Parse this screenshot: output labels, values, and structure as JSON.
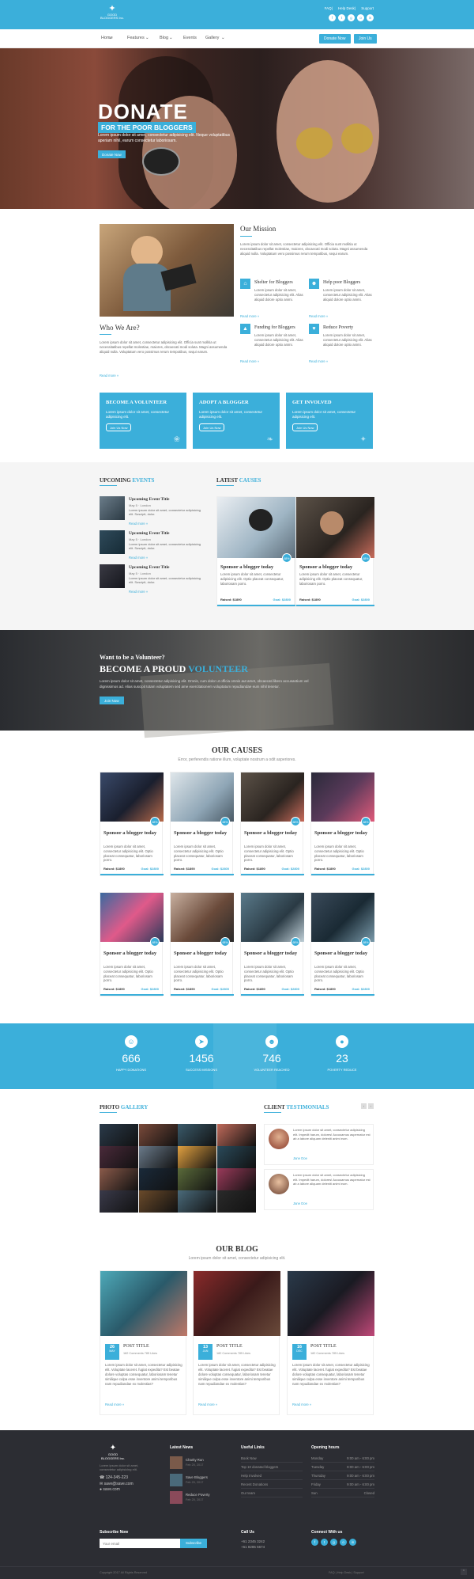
{
  "logo": {
    "name": "GOOD BLOGGERS Inc."
  },
  "top_links": [
    "FAQ",
    "Help Desk",
    "Support"
  ],
  "social_icons": [
    "facebook-icon",
    "twitter-icon",
    "google-plus-icon",
    "instagram-icon",
    "linkedin-icon"
  ],
  "nav": {
    "items": [
      "Home",
      "Features",
      "Blog",
      "Events",
      "Gallery"
    ],
    "donate": "Donate Now",
    "join": "Join Us"
  },
  "hero": {
    "title": "DONATE",
    "subtitle": "FOR THE POOR BLOGGERS",
    "text": "Lorem ipsum dolor sit amet, consectetur adipisicing elit. Neque voluptatibus aperiam nihil, earum consectetur laboriosam.",
    "button": "Donate Now"
  },
  "who": {
    "title": "Who We Are?",
    "text": "Lorem ipsum dolor sit amet, consectetur adipisicing elit. Officia sunt mollitia ut necessitatibus repellat molestiae, maiores, obcaecati modi soluta. Magni assumenda aliquid nulla. Voluptatum vero possimus rerum tempotibus, sequi earum.",
    "more": "Read more"
  },
  "mission": {
    "title": "Our Mission",
    "text": "Lorem ipsum dolor sit amet, consectetur adipisicing elit. Officia sunt mollitia ut necessitatibus repellat molestiae, maiores, obcaecati modi soluta. Magni assumenda aliquid nulla. Voluptatum vero possimus rerum tempotibus, sequi earum.",
    "features": [
      {
        "title": "Shelter for Bloggers",
        "text": "Lorem ipsum dolor sit amet, consectetur adipisicing elit. Alias aliquid dolore optio animi.",
        "more": "Read more"
      },
      {
        "title": "Help poor Bloggers",
        "text": "Lorem ipsum dolor sit amet, consectetur adipisicing elit. Alias aliquid dolore optio animi.",
        "more": "Read more"
      },
      {
        "title": "Funding for Bloggers",
        "text": "Lorem ipsum dolor sit amet, consectetur adipisicing elit. Alias aliquid dolore optio animi.",
        "more": "Read more"
      },
      {
        "title": "Reduce Poverty",
        "text": "Lorem ipsum dolor sit amet, consectetur adipisicing elit. Alias aliquid dolore optio animi.",
        "more": "Read more"
      }
    ]
  },
  "boxes": [
    {
      "title": "BECOME A VOLUNTEER",
      "text": "Lorem ipsum dolor sit amet, consectetur adipisicing elit.",
      "button": "Join Us Now"
    },
    {
      "title": "ADOPT A BLOGGER",
      "text": "Lorem ipsum dolor sit amet, consectetur adipisicing elit.",
      "button": "Join Us Now"
    },
    {
      "title": "GET INVOLVED",
      "text": "Lorem ipsum dolor sit amet, consectetur adipisicing elit.",
      "button": "Join Us Now"
    }
  ],
  "events": {
    "title_a": "UPCOMING ",
    "title_b": "EVENTS",
    "items": [
      {
        "title": "Upcoming Event Title",
        "meta": "May 5 · London",
        "text": "Lorem ipsum dolor sit amet, consectetur adipisicing elit. Suscipit, dolor.",
        "more": "Read more"
      },
      {
        "title": "Upcoming Event Title",
        "meta": "May 5 · London",
        "text": "Lorem ipsum dolor sit amet, consectetur adipisicing elit. Suscipit, dolor.",
        "more": "Read more"
      },
      {
        "title": "Upcoming Event Title",
        "meta": "May 5 · London",
        "text": "Lorem ipsum dolor sit amet, consectetur adipisicing elit. Suscipit, dolor.",
        "more": "Read more"
      }
    ]
  },
  "latest": {
    "title_a": "LATEST ",
    "title_b": "CAUSES",
    "items": [
      {
        "title": "Sponsor a blogger today",
        "text": "Lorem ipsum dolor sit amet, consectetur adipisicing elit. Optio placeat consequatur, laboriosam porro.",
        "raised": "Raised: $1890",
        "goal": "Goal: $2800",
        "pct": "68%"
      },
      {
        "title": "Sponsor a blogger today",
        "text": "Lorem ipsum dolor sit amet, consectetur adipisicing elit. Optio placeat consequatur, laboriosam porro.",
        "raised": "Raised: $1890",
        "goal": "Goal: $2800",
        "pct": "68%"
      }
    ]
  },
  "volunteer": {
    "pre": "Want to be a Volunteer?",
    "title_a": "BECOME A PROUD ",
    "title_b": "VOLUNTEER",
    "text": "Lorem ipsum dolor sit amet, consectetur adipisicing elit. Omnis, cum dolor ut officia omnis aut amet, obcaecati libero accusantium vel dignissimos ad. Alias suscipit totam voluptatem sed ame exercitationem voluptatum repudiandae eum nihil tenetur.",
    "button": "Join Now"
  },
  "causes": {
    "title": "OUR CAUSES",
    "subtitle": "Error, perferendis ratione illum, voluptate nostrum a odit asperiores.",
    "items": [
      {
        "title": "Sponsor a blogger today",
        "text": "Lorem ipsum dolor sit amet, consectetur adipisicing elit. Optio placeat consequatur, laboriosam porro.",
        "raised": "Raised: $1890",
        "goal": "Goal: $2800",
        "pct": "68%"
      },
      {
        "title": "Sponsor a blogger today",
        "text": "Lorem ipsum dolor sit amet, consectetur adipisicing elit. Optio placeat consequatur, laboriosam porro.",
        "raised": "Raised: $1890",
        "goal": "Goal: $2800",
        "pct": "68%"
      },
      {
        "title": "Sponsor a blogger today",
        "text": "Lorem ipsum dolor sit amet, consectetur adipisicing elit. Optio placeat consequatur, laboriosam porro.",
        "raised": "Raised: $1890",
        "goal": "Goal: $2800",
        "pct": "68%"
      },
      {
        "title": "Sponsor a blogger today",
        "text": "Lorem ipsum dolor sit amet, consectetur adipisicing elit. Optio placeat consequatur, laboriosam porro.",
        "raised": "Raised: $1890",
        "goal": "Goal: $2800",
        "pct": "68%"
      },
      {
        "title": "Sponsor a blogger today",
        "text": "Lorem ipsum dolor sit amet, consectetur adipisicing elit. Optio placeat consequatur, laboriosam porro.",
        "raised": "Raised: $1890",
        "goal": "Goal: $2800",
        "pct": "68%"
      },
      {
        "title": "Sponsor a blogger today",
        "text": "Lorem ipsum dolor sit amet, consectetur adipisicing elit. Optio placeat consequatur, laboriosam porro.",
        "raised": "Raised: $1890",
        "goal": "Goal: $2800",
        "pct": "68%"
      },
      {
        "title": "Sponsor a blogger today",
        "text": "Lorem ipsum dolor sit amet, consectetur adipisicing elit. Optio placeat consequatur, laboriosam porro.",
        "raised": "Raised: $1890",
        "goal": "Goal: $2800",
        "pct": "68%"
      },
      {
        "title": "Sponsor a blogger today",
        "text": "Lorem ipsum dolor sit amet, consectetur adipisicing elit. Optio placeat consequatur, laboriosam porro.",
        "raised": "Raised: $1890",
        "goal": "Goal: $2800",
        "pct": "68%"
      }
    ]
  },
  "counters": [
    {
      "icon": "smile-icon",
      "num": "666",
      "label": "HAPPY DONATIONS"
    },
    {
      "icon": "rocket-icon",
      "num": "1456",
      "label": "SUCCESS MISSIONS"
    },
    {
      "icon": "users-icon",
      "num": "746",
      "label": "VOLUNTEER REACHED"
    },
    {
      "icon": "globe-icon",
      "num": "23",
      "label": "POVERTY REDUCE"
    }
  ],
  "gallery": {
    "title_a": "PHOTO ",
    "title_b": "GALLERY"
  },
  "testimonials": {
    "title_a": "CLIENT ",
    "title_b": "TESTIMONIALS",
    "items": [
      {
        "text": "Lorem ipsum dolor sit amet, consectetur adipisicing elit. Impedit harum, dolores! Accusamus aspernatur est ab a labore aliquam deleniti animi eum.",
        "name": "Jane Doe"
      },
      {
        "text": "Lorem ipsum dolor sit amet, consectetur adipisicing elit. Impedit harum, dolores! Accusamus aspernatur est ab a labore aliquam deleniti animi eum.",
        "name": "Jane Doe"
      }
    ]
  },
  "blog": {
    "title": "OUR BLOG",
    "subtitle": "Lorem ipsum dolor sit amet, consectetur adipisicing elit.",
    "posts": [
      {
        "day": "26",
        "month": "MAY",
        "title": "POST TITLE",
        "meta": "182 Comments  785 Likes",
        "text": "Lorem ipsum dolor sit amet, consectetur adipisicing elit. Voluptate laceret. fugiat expedita? Est beatae dolore voluptas consequatur, laboriosam tenetur similique culpa esse inventore animi temporibus nam repudiandae ex molestias?",
        "more": "Read more"
      },
      {
        "day": "13",
        "month": "JUN",
        "title": "POST TITLE",
        "meta": "182 Comments  785 Likes",
        "text": "Lorem ipsum dolor sit amet, consectetur adipisicing elit. Voluptate laceret. fugiat expedita? Est beatae dolore voluptas consequatur, laboriosam tenetur similique culpa esse inventore animi temporibus nam repudiandae ex molestias?",
        "more": "Read more"
      },
      {
        "day": "16",
        "month": "DEC",
        "title": "POST TITLE",
        "meta": "182 Comments  785 Likes",
        "text": "Lorem ipsum dolor sit amet, consectetur adipisicing elit. Voluptate laceret. fugiat expedita? Est beatae dolore voluptas consequatur, laboriosam tenetur similique culpa esse inventore animi temporibus nam repudiandae ex molestias?",
        "more": "Read more"
      }
    ]
  },
  "footer": {
    "about": "GOOD BLOGGERS Inc.",
    "about_text": "Lorem ipsum dolor sit amet, consectetur adipisicing elit.",
    "phone": "124-345-223",
    "email1": "save@save.com",
    "site": "save.com",
    "latest_title": "Latest News",
    "news": [
      {
        "title": "Charity Run",
        "date": "Feb 20, 2017"
      },
      {
        "title": "Save Bloggers",
        "date": "Feb 20, 2017"
      },
      {
        "title": "Reduce Poverty",
        "date": "Feb 20, 2017"
      }
    ],
    "links_title": "Useful Links",
    "links": [
      "Book Now",
      "Top 10 donated bloggers",
      "Help Involved",
      "Recent Donations",
      "Our team"
    ],
    "hours_title": "Opening hours",
    "hours": [
      {
        "d": "Monday",
        "h": "9:00 am - 6:00 pm"
      },
      {
        "d": "Tuesday",
        "h": "9:00 am - 6:00 pm"
      },
      {
        "d": "Thursday",
        "h": "9:00 am - 6:00 pm"
      },
      {
        "d": "Friday",
        "h": "9:00 am - 6:00 pm"
      },
      {
        "d": "Sun",
        "h": "Closed"
      }
    ],
    "sub_title": "Subscribe Now",
    "sub_placeholder": "Your email",
    "sub_button": "Subscribe",
    "call_title": "Call Us",
    "call1": "+61 2345 3242",
    "call2": "+61 8285 5674",
    "connect_title": "Connect With us",
    "copy": "Copyright 2017 All Rights Reserved",
    "bottom_links": [
      "FAQ",
      "Help Desk",
      "Support"
    ]
  }
}
